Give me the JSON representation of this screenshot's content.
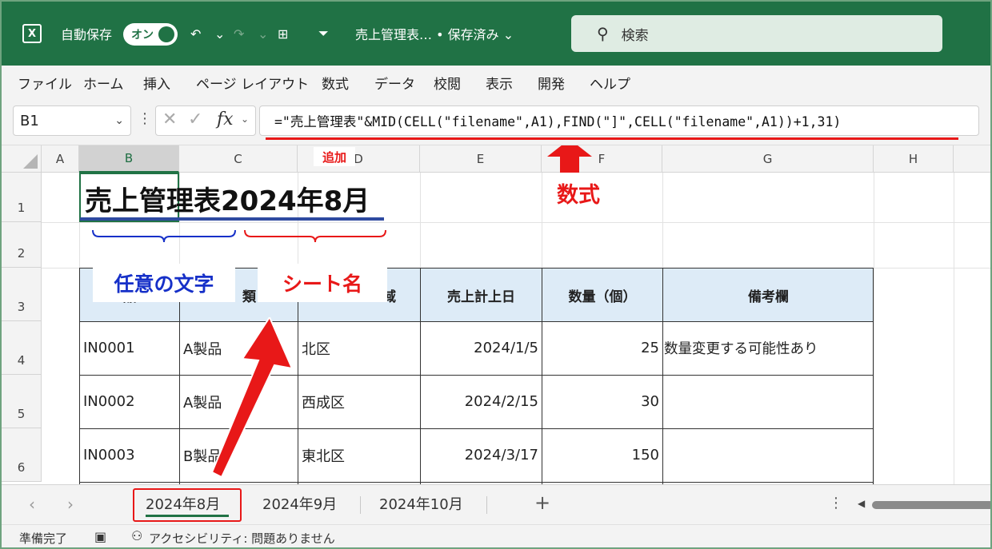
{
  "titlebar": {
    "logo": "excel-logo",
    "autosave_label": "自動保存",
    "toggle_label": "オン",
    "undo_glyph": "↶",
    "redo_glyph": "↷",
    "caret": "⌄",
    "grid_glyph": "⊞",
    "qa_caret": "⏷",
    "doc_title": "売上管理表… • 保存済み ⌄",
    "search_placeholder": "検索",
    "color": "#207245"
  },
  "menu": [
    "ファイル",
    "ホーム",
    "挿入",
    "ページ レイアウト",
    "数式",
    "データ",
    "校閲",
    "表示",
    "開発",
    "ヘルプ"
  ],
  "formulabar": {
    "namebox": "B1",
    "fx": "fx",
    "formula": "=\"売上管理表\"&MID(CELL(\"filename\",A1),FIND(\"]\",CELL(\"filename\",A1))+1,31)"
  },
  "grid": {
    "columns": [
      "A",
      "B",
      "C",
      "D",
      "E",
      "F",
      "G",
      "H"
    ],
    "rows": [
      "1",
      "2",
      "3",
      "4",
      "5",
      "6"
    ],
    "title": "売上管理表2024年8月",
    "headers": [
      "品",
      "類",
      "域",
      "売上計上日",
      "数量（個）",
      "備考欄"
    ],
    "data": [
      [
        "IN0001",
        "A製品",
        "北区",
        "2024/1/5",
        "25",
        "数量変更する可能性あり"
      ],
      [
        "IN0002",
        "A製品",
        "西成区",
        "2024/2/15",
        "30",
        ""
      ],
      [
        "IN0003",
        "B製品",
        "東北区",
        "2024/3/17",
        "150",
        ""
      ]
    ]
  },
  "annotations": {
    "arbitrary_text": "任意の文字",
    "sheet_name": "シート名",
    "added": "追加",
    "formula": "数式",
    "accent_red": "#e81818",
    "accent_blue": "#1630c8"
  },
  "tabs": {
    "items": [
      "2024年8月",
      "2024年9月",
      "2024年10月"
    ],
    "active": 0,
    "add": "+",
    "dots": "⋮"
  },
  "status": {
    "ready": "準備完了",
    "accessibility": "アクセシビリティ: 問題ありません"
  }
}
